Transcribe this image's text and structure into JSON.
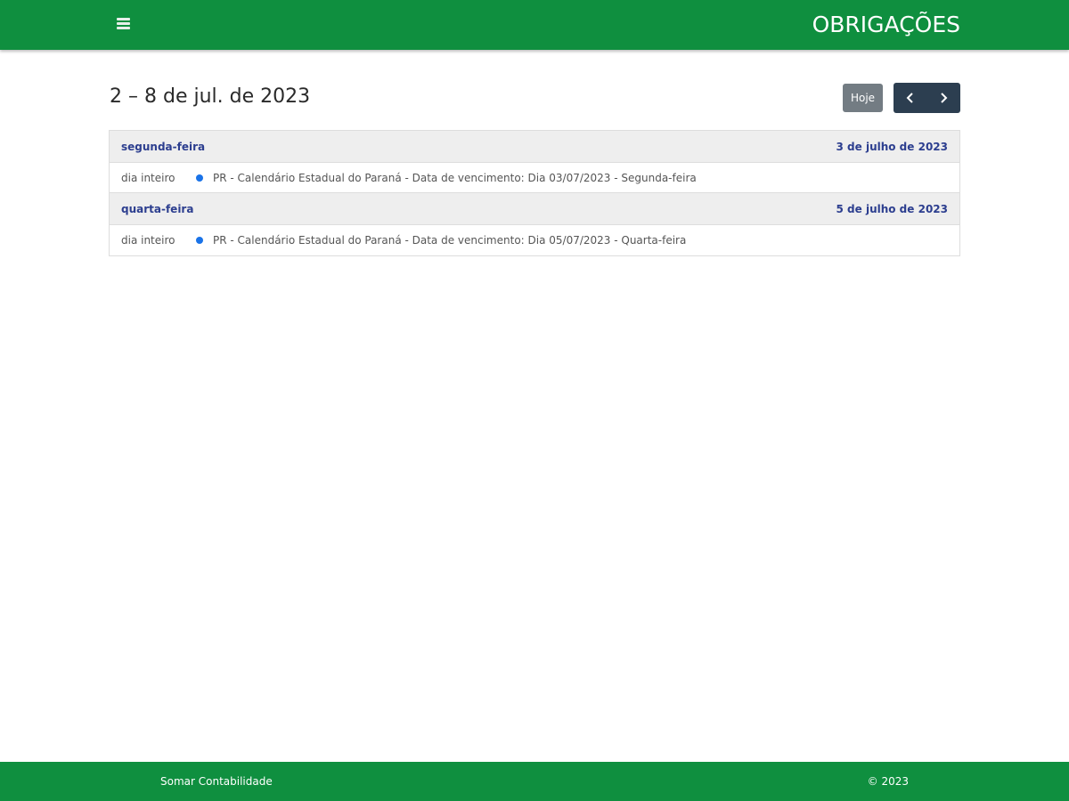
{
  "header": {
    "title": "OBRIGAÇÕES",
    "menu_icon": "hamburger-icon"
  },
  "toolbar": {
    "range_title": "2 – 8 de jul. de 2023",
    "today_label": "Hoje",
    "prev_icon": "chevron-left-icon",
    "next_icon": "chevron-right-icon"
  },
  "days": [
    {
      "name": "segunda-feira",
      "date": "3 de julho de 2023",
      "events": [
        {
          "time": "dia inteiro",
          "title": "PR - Calendário Estadual do Paraná - Data de vencimento: Dia 03/07/2023 - Segunda-feira"
        }
      ]
    },
    {
      "name": "quarta-feira",
      "date": "5 de julho de 2023",
      "events": [
        {
          "time": "dia inteiro",
          "title": "PR - Calendário Estadual do Paraná - Data de vencimento: Dia 05/07/2023 - Quarta-feira"
        }
      ]
    }
  ],
  "footer": {
    "left": "Somar Contabilidade",
    "right": "© 2023"
  },
  "colors": {
    "brand_green": "#0f8f3f",
    "event_dot": "#1a73e8",
    "nav_dark": "#2c3e50",
    "today_gray": "#6c757d",
    "day_link": "#2c3e8f"
  }
}
